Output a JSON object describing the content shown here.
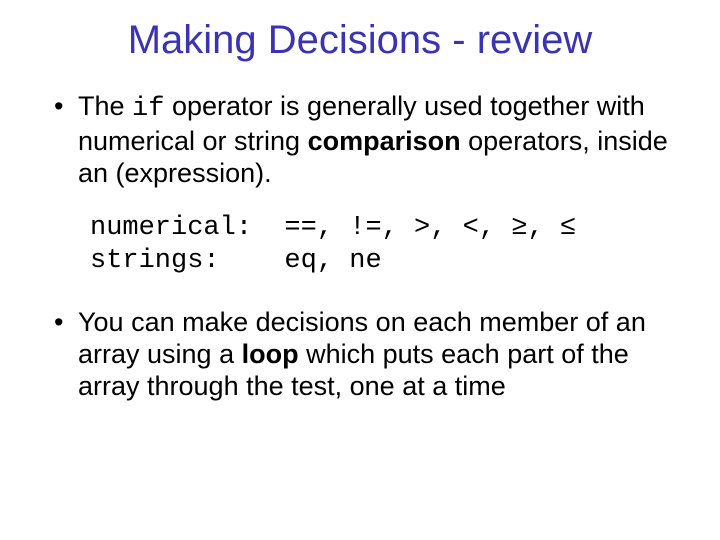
{
  "title": "Making Decisions - review",
  "bullet1": {
    "pre_if": "The ",
    "if_kw": "if",
    "post_if": " operator is generally used together with numerical or string ",
    "comparison": "comparison",
    "rest": " operators, inside an (expression)."
  },
  "code": {
    "line1": "numerical:  ==, !=, >, <, ≥, ≤",
    "line2": "strings:    eq, ne"
  },
  "bullet2": {
    "pre": "You can make decisions on each member of an array using a ",
    "loop": "loop",
    "post": " which puts each part of the array through the test, one at a time"
  }
}
